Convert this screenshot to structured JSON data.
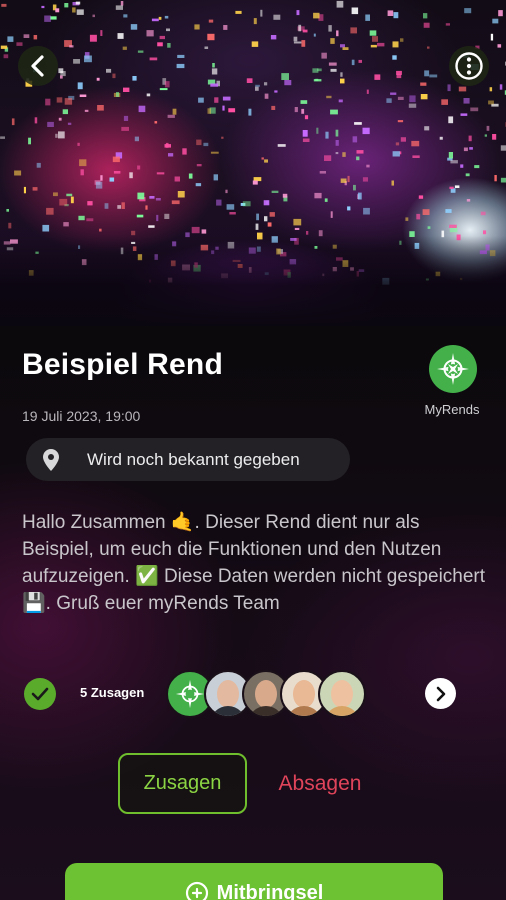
{
  "header": {
    "back_icon": "chevron-left-icon",
    "menu_icon": "more-vertical-icon",
    "hero_image": "confetti-concert-photo"
  },
  "event": {
    "title": "Beispiel Rend",
    "datetime": "19 Juli 2023, 19:00",
    "location": "Wird noch bekannt gegeben",
    "description": "Hallo Zusammen 🤙. Dieser Rend dient nur als Beispiel, um euch die Funktionen und den Nutzen aufzuzeigen. ✅ Diese Daten werden nicht gespeichert 💾. Gruß euer myRends Team"
  },
  "organizer": {
    "name": "MyRends",
    "logo_icon": "compass-logo-icon"
  },
  "attendees": {
    "count_label": "5 Zusagen",
    "avatars": [
      "myrends-logo",
      "person-1",
      "person-2",
      "person-3",
      "person-4"
    ]
  },
  "actions": {
    "accept_label": "Zusagen",
    "decline_label": "Absagen",
    "bring_label": "Mitbringsel"
  },
  "colors": {
    "accent_green": "#6cc232",
    "decline_red": "#e0445a",
    "background": "#0d0a0e"
  }
}
